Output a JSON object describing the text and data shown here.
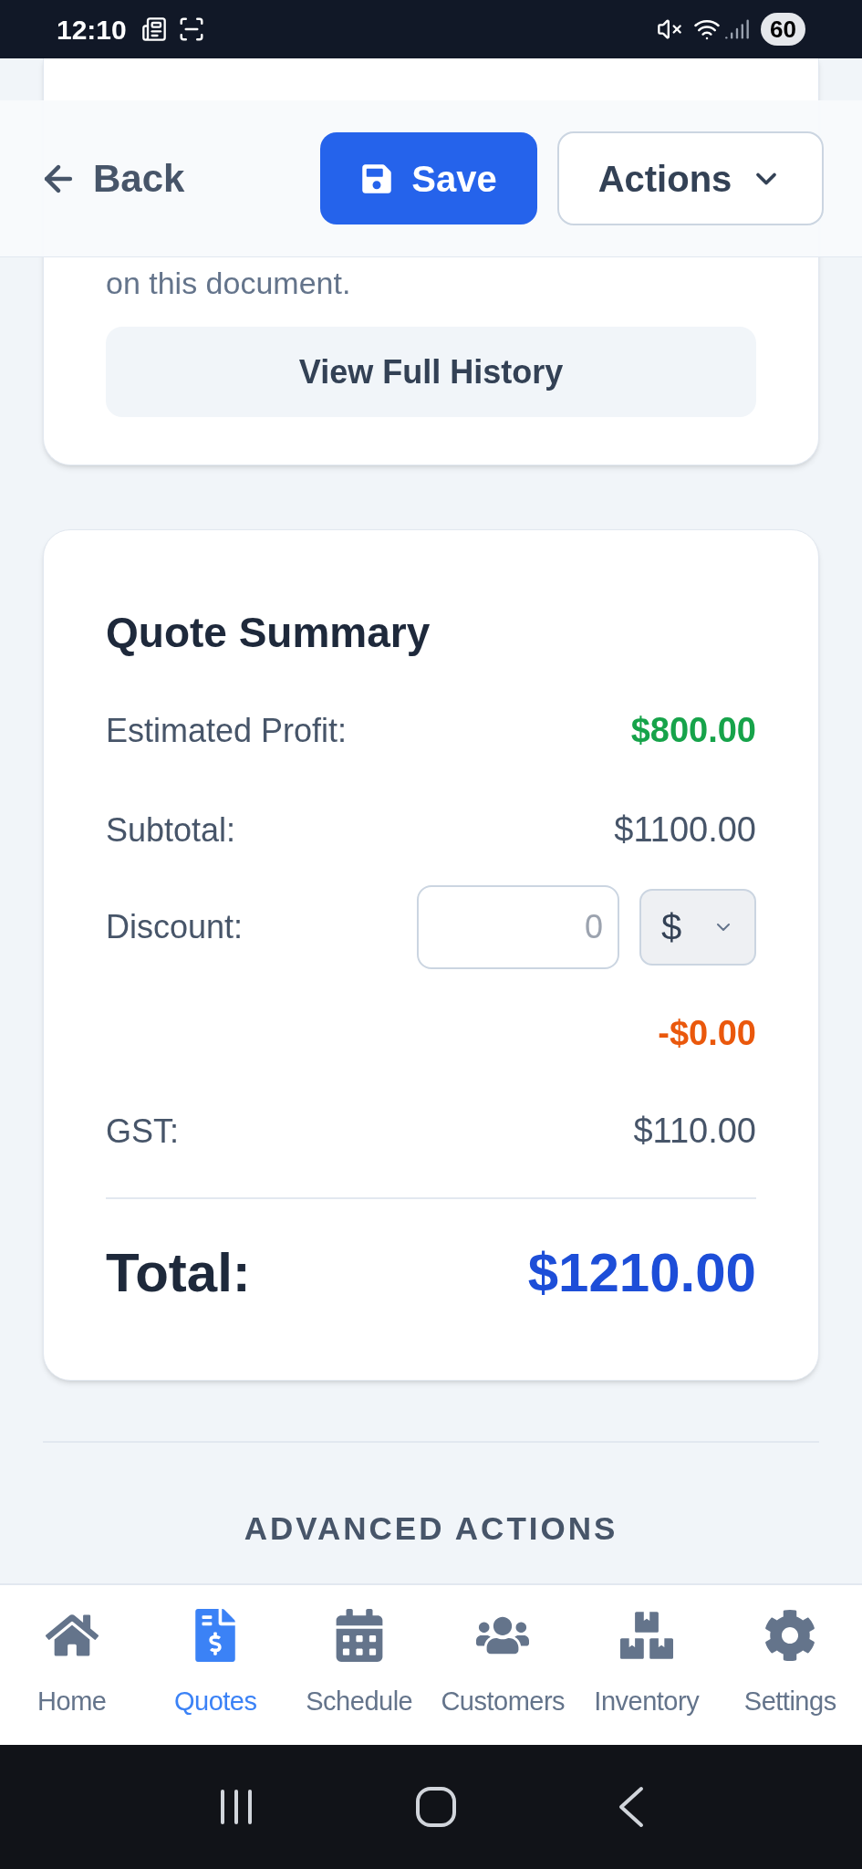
{
  "status_bar": {
    "time": "12:10",
    "battery": "60"
  },
  "header": {
    "back": "Back",
    "save": "Save",
    "actions": "Actions"
  },
  "activity_card": {
    "description_tail": "on this document.",
    "button": "View Full History"
  },
  "quote_summary": {
    "title": "Quote Summary",
    "estimated_profit": {
      "label": "Estimated Profit:",
      "value": "$800.00"
    },
    "subtotal": {
      "label": "Subtotal:",
      "value": "$1100.00"
    },
    "discount": {
      "label": "Discount:",
      "placeholder": "0",
      "unit": "$",
      "amount": "-$0.00"
    },
    "gst": {
      "label": "GST:",
      "value": "$110.00"
    },
    "total": {
      "label": "Total:",
      "value": "$1210.00"
    }
  },
  "advanced_actions": {
    "heading": "ADVANCED ACTIONS"
  },
  "bottom_nav": [
    {
      "kind": "home",
      "label": "Home",
      "selected": false
    },
    {
      "kind": "quotes",
      "label": "Quotes",
      "selected": true
    },
    {
      "kind": "schedule",
      "label": "Schedule",
      "selected": false
    },
    {
      "kind": "customers",
      "label": "Customers",
      "selected": false
    },
    {
      "kind": "inventory",
      "label": "Inventory",
      "selected": false
    },
    {
      "kind": "settings",
      "label": "Settings",
      "selected": false
    }
  ]
}
